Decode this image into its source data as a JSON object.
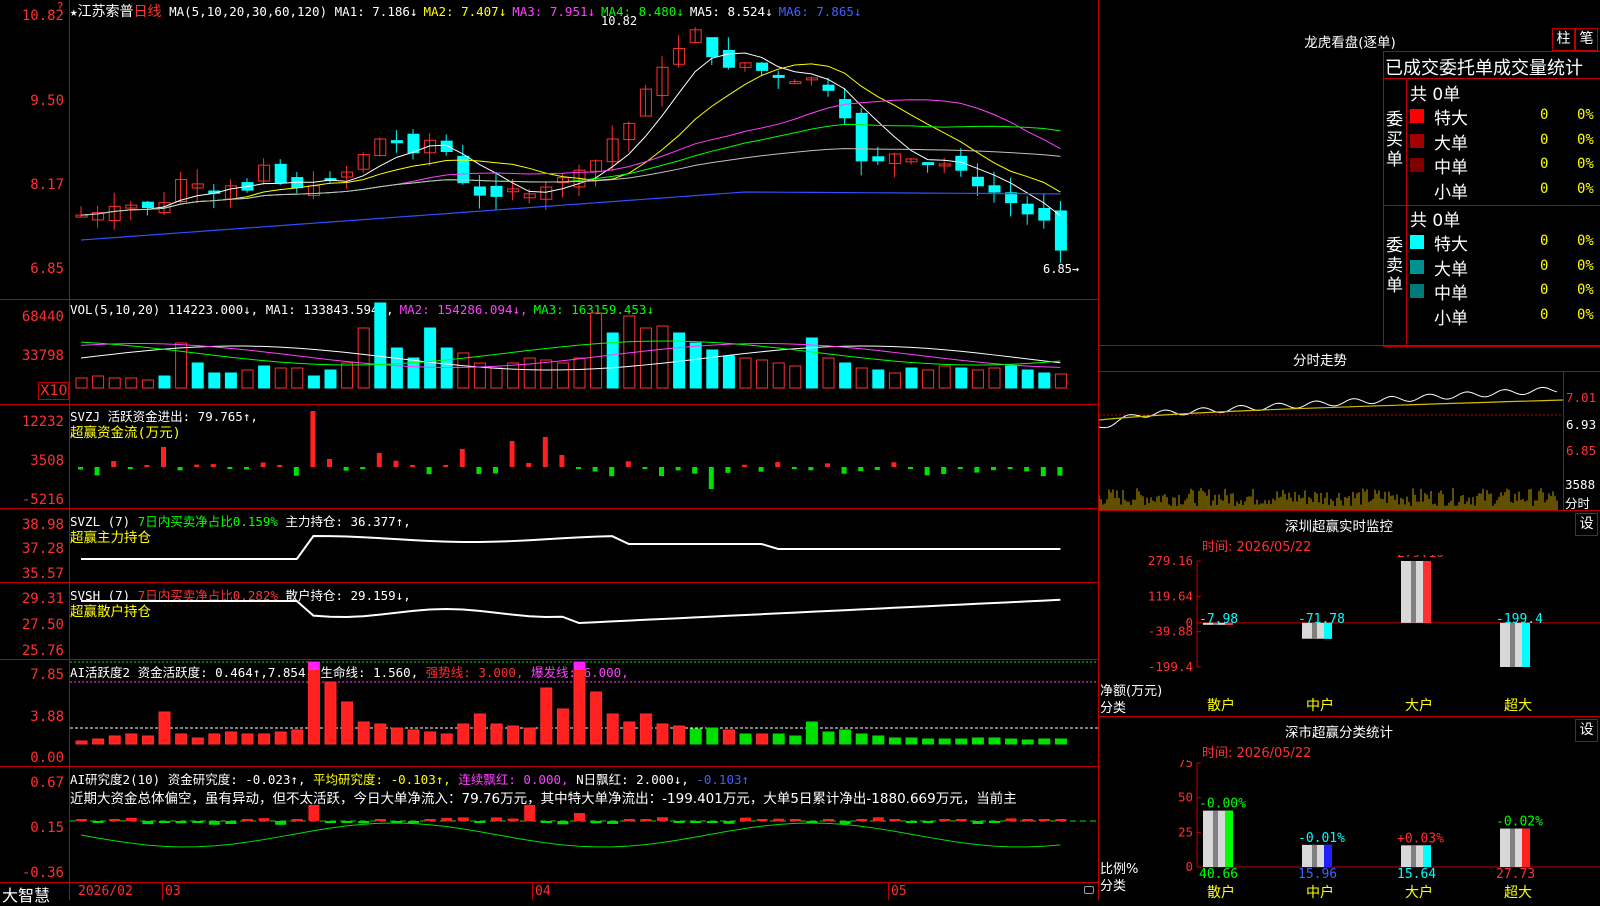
{
  "main_chart": {
    "stock_name": "江苏索普",
    "period": "日线",
    "ma_params": "MA(5,10,20,30,60,120)",
    "ma_items": [
      {
        "label": "MA1: 7.186↓",
        "color": "#ffffff"
      },
      {
        "label": "MA2: 7.407↓",
        "color": "#ffff00"
      },
      {
        "label": "MA3: 7.951↓",
        "color": "#ff40ff"
      },
      {
        "label": "MA4: 8.480↓",
        "color": "#00ff00"
      },
      {
        "label": "MA5: 8.524↓",
        "color": "#ffffff"
      },
      {
        "label": "MA6: 7.865↓",
        "color": "#4060ff"
      }
    ],
    "y_ticks": [
      "10.82",
      "9.50",
      "8.17",
      "6.85"
    ],
    "high_label": "10.82",
    "low_label": "6.85→",
    "marker": "★"
  },
  "volume": {
    "header": "VOL(5,10,20)",
    "value": "114223.000↓,",
    "ma_items": [
      {
        "label": "MA1: 133843.594↓,",
        "color": "#ffffff"
      },
      {
        "label": "MA2: 154286.094↓,",
        "color": "#ff40ff"
      },
      {
        "label": "MA3: 163159.453↓",
        "color": "#00ff00"
      }
    ],
    "y_ticks": [
      "68440",
      "33798"
    ],
    "unit": "X10"
  },
  "svzj": {
    "header": "SVZJ  活跃资金进出: 79.765↑,",
    "subtitle": "超赢资金流(万元)",
    "y_ticks": [
      "12232",
      "3508",
      "-5216"
    ]
  },
  "svzl": {
    "header_name": "SVZL (7)",
    "header_ratio": "7日内买卖净占比0.159%",
    "header_hold": "主力持仓: 36.377↑,",
    "subtitle": "超赢主力持仓",
    "y_ticks": [
      "38.98",
      "37.28",
      "35.57"
    ]
  },
  "svsh": {
    "header_name": "SVSH (7)",
    "header_ratio": "7日内买卖净占比0.282%",
    "header_hold": "散户持仓: 29.159↓,",
    "subtitle": "超赢散户持仓",
    "y_ticks": [
      "29.31",
      "27.50",
      "25.76"
    ]
  },
  "ai_active": {
    "header_name": "AI活跃度2",
    "header_a": "资金活跃度: 0.464↑,7.854,",
    "header_b": "生命线: 1.560,",
    "header_c": "强势线: 3.000,",
    "header_d": "爆发线: 6.000,",
    "y_ticks": [
      "7.85",
      "3.88",
      "0.00"
    ]
  },
  "ai_research": {
    "header_name": "AI研究度2(10)",
    "header_a": "资金研究度: -0.023↑,",
    "header_b": "平均研究度: -0.103↑,",
    "header_c": "连续飘红: 0.000,",
    "header_d": "N日飘红: 2.000↓,",
    "header_e": "-0.103↑",
    "comment": "近期大资金总体偏空，虽有异动，但不太活跃，今日大单净流入：79.76万元，其中特大单净流出：-199.401万元，大单5日累计净出-1880.669万元，当前主",
    "y_ticks": [
      "0.67",
      "0.15",
      "-0.36"
    ]
  },
  "x_axis": {
    "labels": [
      "2026/02",
      "03",
      "04",
      "05"
    ],
    "brand": "大智慧"
  },
  "right_panel": {
    "title": "龙虎看盘(逐单)",
    "buttons": [
      "柱",
      "笔"
    ],
    "table_title": "已成交委托单成交量统计",
    "buy_side": {
      "label": "委买单",
      "total": "共 0单",
      "rows": [
        {
          "name": "特大",
          "value": "0",
          "pct": "0%",
          "color": "#ff0000"
        },
        {
          "name": "大单",
          "value": "0",
          "pct": "0%",
          "color": "#a00000"
        },
        {
          "name": "中单",
          "value": "0",
          "pct": "0%",
          "color": "#800000"
        },
        {
          "name": "小单",
          "value": "0",
          "pct": "0%",
          "color": ""
        }
      ]
    },
    "sell_side": {
      "label": "委卖单",
      "total": "共 0单",
      "rows": [
        {
          "name": "特大",
          "value": "0",
          "pct": "0%",
          "color": "#00ffff"
        },
        {
          "name": "大单",
          "value": "0",
          "pct": "0%",
          "color": "#009090"
        },
        {
          "name": "中单",
          "value": "0",
          "pct": "0%",
          "color": "#007878"
        },
        {
          "name": "小单",
          "value": "0",
          "pct": "0%",
          "color": ""
        }
      ]
    },
    "intraday": {
      "title": "分时走势",
      "y_ticks": [
        "7.01",
        "6.93",
        "6.85"
      ],
      "vol_label": "3588",
      "vol_unit": "分时"
    },
    "sz_monitor": {
      "title": "深圳超赢实时监控",
      "set_button": "设",
      "time": "时间: 2026/05/22",
      "y_ticks": [
        "279.16",
        "119.64",
        "0",
        "-39.88",
        "-199.4"
      ],
      "axis_label": "净额(万元)",
      "category_label": "分类",
      "chart_data": {
        "type": "bar",
        "categories": [
          "散户",
          "中户",
          "大户",
          "超大"
        ],
        "values": [
          -7.98,
          -71.78,
          279.16,
          -199.4
        ],
        "value_labels": [
          "-7.98",
          "-71.78",
          "279.16",
          "-199.4"
        ],
        "ylim": [
          -199.4,
          279.16
        ]
      }
    },
    "sz_class": {
      "title": "深市超赢分类统计",
      "set_button": "设",
      "time": "时间: 2026/05/22",
      "y_ticks": [
        "75",
        "50",
        "25",
        "0"
      ],
      "axis_label": "比例%",
      "category_label": "分类",
      "chart_data": {
        "type": "bar",
        "categories": [
          "散户",
          "中户",
          "大户",
          "超大"
        ],
        "values": [
          40.66,
          15.96,
          15.64,
          27.73
        ],
        "change_labels": [
          "-0.00%",
          "-0.01%",
          "+0.03%",
          "-0.02%"
        ],
        "value_labels": [
          "40.66",
          "15.96",
          "15.64",
          "27.73"
        ],
        "ylim": [
          0,
          75
        ]
      }
    }
  }
}
